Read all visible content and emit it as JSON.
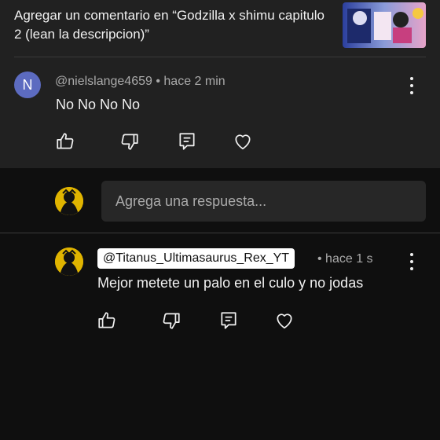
{
  "header": {
    "title": "Agregar un comentario en “Godzilla x shimu capitulo 2 (lean la descripcion)”",
    "thumbnail_icon": "video-thumbnail"
  },
  "comment": {
    "avatar_letter": "N",
    "author": "@nielslange4659",
    "time": "• hace 2 min",
    "text": "No No No No",
    "actions": [
      "like-icon",
      "dislike-icon",
      "reply-icon",
      "heart-icon"
    ]
  },
  "reply_input": {
    "placeholder": "Agrega una respuesta..."
  },
  "reply": {
    "author": "@Titanus_Ultimasaurus_Rex_YT",
    "time": "• hace 1 s",
    "text": "Mejor metete un palo en el culo y no jodas",
    "actions": [
      "like-icon",
      "dislike-icon",
      "reply-icon",
      "heart-icon"
    ]
  },
  "colors": {
    "top_background": "#212121",
    "page_background": "#0f0f0f",
    "avatar_n": "#5c6bc0",
    "avatar_user": "#e0b400"
  }
}
